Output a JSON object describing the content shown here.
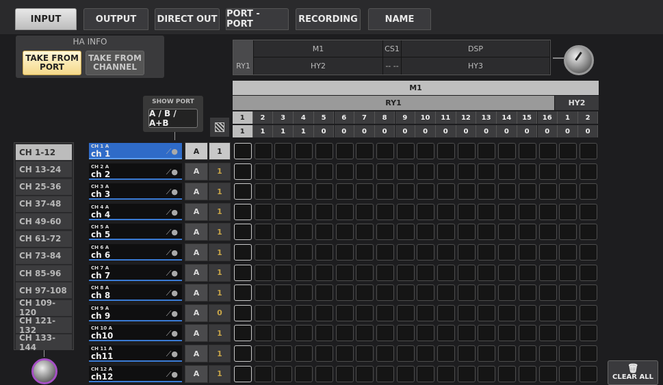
{
  "tabs": [
    {
      "label": "INPUT",
      "active": true
    },
    {
      "label": "OUTPUT",
      "active": false
    },
    {
      "label": "DIRECT OUT",
      "active": false
    },
    {
      "label": "PORT - PORT",
      "active": false
    },
    {
      "label": "RECORDING",
      "active": false
    },
    {
      "label": "NAME",
      "active": false
    }
  ],
  "ha_info": {
    "title": "HA INFO",
    "take_from_port": "TAKE FROM PORT",
    "take_from_channel": "TAKE FROM CHANNEL"
  },
  "overview": {
    "top": [
      "M1",
      "CS1",
      "DSP"
    ],
    "bottom": [
      "RY1",
      "HY2",
      "-- --",
      "HY3"
    ]
  },
  "matrix_header": {
    "group": "M1",
    "slot_ry1": "RY1",
    "slot_hy2": "HY2",
    "ports_top": [
      "1",
      "2",
      "3",
      "4",
      "5",
      "6",
      "7",
      "8",
      "9",
      "10",
      "11",
      "12",
      "13",
      "14",
      "15",
      "16",
      "1",
      "2"
    ],
    "ports_bottom": [
      "1",
      "1",
      "1",
      "1",
      "0",
      "0",
      "0",
      "0",
      "0",
      "0",
      "0",
      "0",
      "0",
      "0",
      "0",
      "0",
      "0",
      "0"
    ]
  },
  "show_port": {
    "label": "SHOW PORT",
    "value": "A / B / A+B"
  },
  "channel_groups": [
    "CH 1-12",
    "CH 13-24",
    "CH 25-36",
    "CH 37-48",
    "CH 49-60",
    "CH 61-72",
    "CH 73-84",
    "CH 85-96",
    "CH 97-108",
    "CH 109-120",
    "CH 121-132",
    "CH 133-144"
  ],
  "channels": [
    {
      "id": "CH 1 A",
      "name": "ch 1",
      "ab": "A",
      "num": "1"
    },
    {
      "id": "CH 2 A",
      "name": "ch 2",
      "ab": "A",
      "num": "1"
    },
    {
      "id": "CH 3 A",
      "name": "ch 3",
      "ab": "A",
      "num": "1"
    },
    {
      "id": "CH 4 A",
      "name": "ch 4",
      "ab": "A",
      "num": "1"
    },
    {
      "id": "CH 5 A",
      "name": "ch 5",
      "ab": "A",
      "num": "1"
    },
    {
      "id": "CH 6 A",
      "name": "ch 6",
      "ab": "A",
      "num": "1"
    },
    {
      "id": "CH 7 A",
      "name": "ch 7",
      "ab": "A",
      "num": "1"
    },
    {
      "id": "CH 8 A",
      "name": "ch 8",
      "ab": "A",
      "num": "1"
    },
    {
      "id": "CH 9 A",
      "name": "ch 9",
      "ab": "A",
      "num": "0"
    },
    {
      "id": "CH 10 A",
      "name": "ch10",
      "ab": "A",
      "num": "1"
    },
    {
      "id": "CH 11 A",
      "name": "ch11",
      "ab": "A",
      "num": "1"
    },
    {
      "id": "CH 12 A",
      "name": "ch12",
      "ab": "A",
      "num": "1"
    }
  ],
  "clear_all": "CLEAR ALL",
  "colors": {
    "accent": "#2f6bc8",
    "ha_active": "#f5d98a",
    "knob_ring": "#a64fc5"
  }
}
